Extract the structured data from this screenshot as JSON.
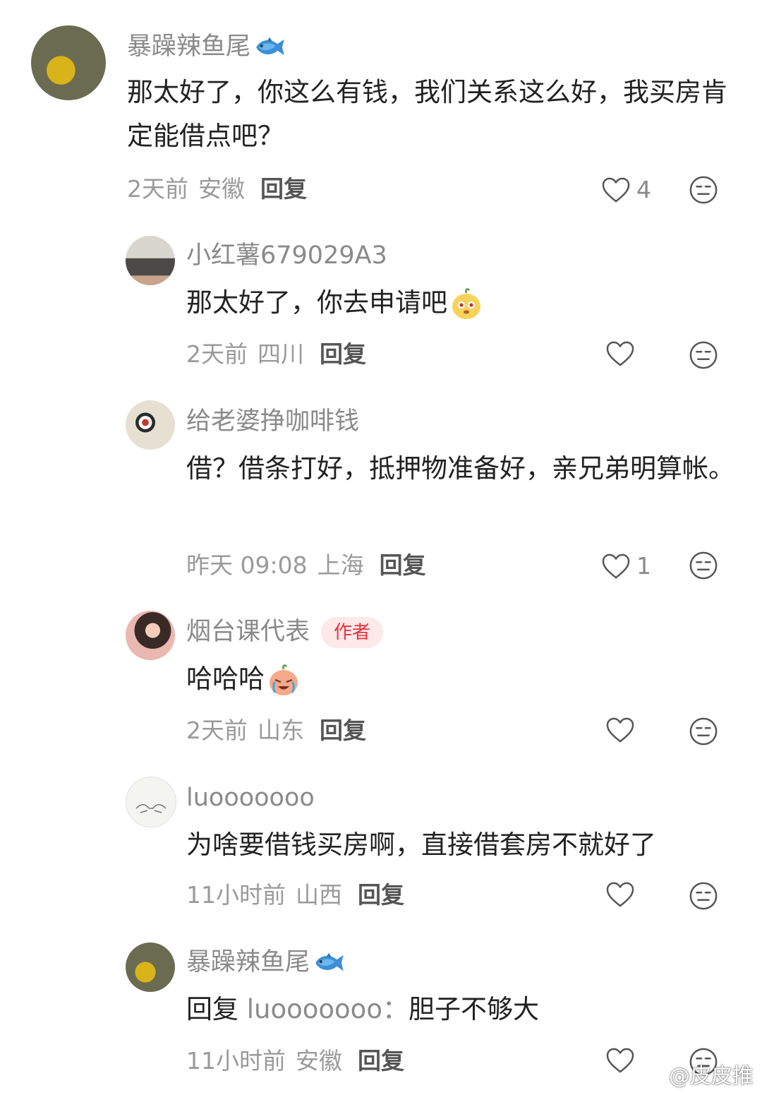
{
  "comments": [
    {
      "username": "暴躁辣鱼尾",
      "text": "那太好了，你这么有钱，我们关系这么好，我买房肯定能借点吧？",
      "time": "2天前",
      "location": "安徽",
      "reply_label": "回复",
      "likes": "4"
    },
    {
      "username": "小红薯679029A3",
      "text": "那太好了，你去申请吧",
      "time": "2天前",
      "location": "四川",
      "reply_label": "回复",
      "likes": ""
    },
    {
      "username": "给老婆挣咖啡钱",
      "text": "借？借条打好，抵押物准备好，亲兄弟明算帐。",
      "time": "昨天 09:08",
      "location": "上海",
      "reply_label": "回复",
      "likes": "1"
    },
    {
      "username": "烟台课代表",
      "badge": "作者",
      "text": "哈哈哈",
      "time": "2天前",
      "location": "山东",
      "reply_label": "回复",
      "likes": ""
    },
    {
      "username": "luooooooo",
      "text": "为啥要借钱买房啊，直接借套房不就好了",
      "time": "11小时前",
      "location": "山西",
      "reply_label": "回复",
      "likes": ""
    },
    {
      "username": "暴躁辣鱼尾",
      "reply_prefix": "回复",
      "reply_target": "luooooooo：",
      "text": "胆子不够大",
      "time": "11小时前",
      "location": "安徽",
      "reply_label": "回复",
      "likes": ""
    }
  ],
  "watermark": "@皮皮推",
  "colors": {
    "meta_gray": "#9a9a9a",
    "name_gray": "#8a8a8a",
    "author_badge_bg": "#fde8ea",
    "author_badge_text": "#e8323f"
  },
  "icons": {
    "like": "heart-outline-icon",
    "dislike": "neutral-face-icon",
    "fish": "fish-emoji-icon"
  }
}
